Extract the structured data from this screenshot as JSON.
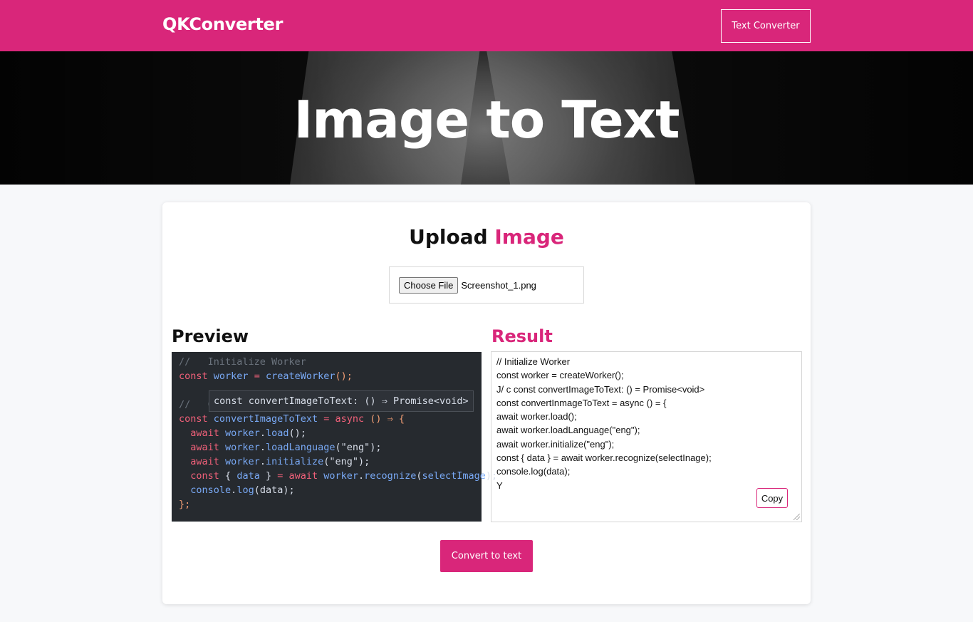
{
  "nav": {
    "brand": "QKConverter",
    "link": "Text Converter"
  },
  "hero": {
    "title": "Image to Text"
  },
  "upload": {
    "title_main": "Upload ",
    "title_accent": "Image",
    "file_button": "Choose File",
    "file_name": "Screenshot_1.png"
  },
  "preview": {
    "title": "Preview",
    "code": [
      "//   Initialize Worker",
      "const worker = createWorker();",
      "",
      "//   C",
      "const convertImageToText = async () ⇒ {",
      "  await worker.load();",
      "  await worker.loadLanguage(\"eng\");",
      "  await worker.initialize(\"eng\");",
      "  const { data } = await worker.recognize(selectImage);",
      "  console.log(data);",
      "};"
    ],
    "tooltip": "const convertImageToText: () ⇒ Promise<void>"
  },
  "result": {
    "title": "Result",
    "lines": [
      "// Initialize Worker",
      "const worker = createWorker();",
      "J/ c const convertImageToText: () = Promise<void>",
      "const convertInmageToText = async () = {",
      "await worker.load();",
      "await worker.loadLanguage(\"eng\");",
      "await worker.initialize(\"eng\");",
      "const { data } = await worker.recognize(selectInage);",
      "console.log(data);",
      "Y"
    ],
    "copy_label": "Copy"
  },
  "actions": {
    "convert_label": "Convert to text"
  },
  "colors": {
    "brand": "#d9267a",
    "code_bg": "#262a2f"
  }
}
